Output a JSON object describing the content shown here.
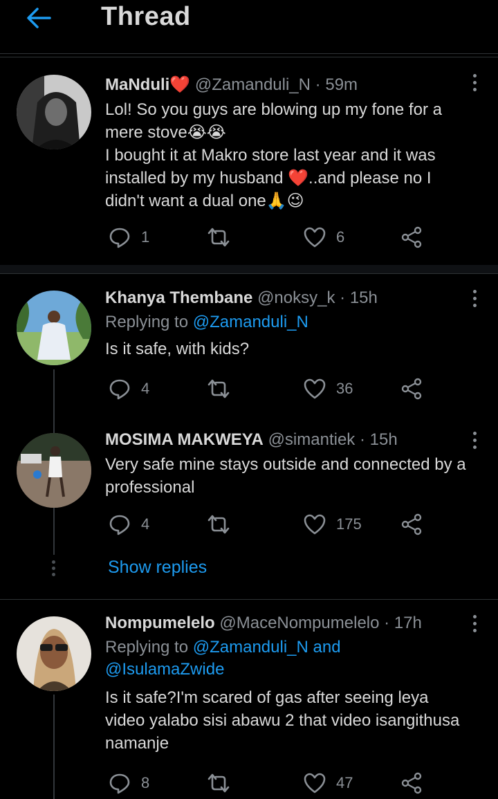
{
  "header": {
    "title": "Thread"
  },
  "tweets": [
    {
      "name": "MaNduli",
      "name_emoji": "❤️",
      "handle": "@Zamanduli_N",
      "time": "59m",
      "replying_label": "",
      "replying_to": "",
      "lines": [
        "Lol! So you guys are blowing up my fone for a",
        "mere stove😭😭",
        "I bought it at Makro store last year and it was",
        "installed by my husband ❤️..and please no I",
        "didn't want a dual one🙏😉"
      ],
      "replies": "1",
      "retweets": "",
      "likes": "6"
    },
    {
      "name": "Khanya Thembane",
      "handle": "@noksy_k",
      "time": "15h",
      "replying_label": "Replying to",
      "replying_to": "@Zamanduli_N",
      "lines": [
        "Is it safe, with kids?"
      ],
      "replies": "4",
      "retweets": "",
      "likes": "36"
    },
    {
      "name": "MOSIMA MAKWEYA",
      "handle": "@simantiek",
      "time": "15h",
      "lines": [
        "Very safe mine stays outside and connected by a",
        "professional"
      ],
      "replies": "4",
      "retweets": "",
      "likes": "175"
    },
    {
      "name": "Nompumelelo",
      "handle": "@MaceNompumelelo",
      "time": "17h",
      "replying_label": "Replying to",
      "replying_to": "@Zamanduli_N",
      "replying_and": "and",
      "replying_to_2": "@IsulamaZwide",
      "lines": [
        "Is it safe?I'm scared of gas after seeing leya",
        "video yalabo sisi abawu 2 that video isangithusa",
        "namanje"
      ],
      "replies": "8",
      "retweets": "",
      "likes": "47"
    }
  ],
  "show_replies": "Show replies",
  "colors": {
    "background": "#000000",
    "accent": "#1d9bf0",
    "muted": "#8b9096",
    "text": "#d9d9d9",
    "divider": "#2f3336"
  },
  "icons": [
    "back-arrow-icon",
    "more-vertical-icon",
    "reply-icon",
    "retweet-icon",
    "like-icon",
    "share-icon"
  ]
}
